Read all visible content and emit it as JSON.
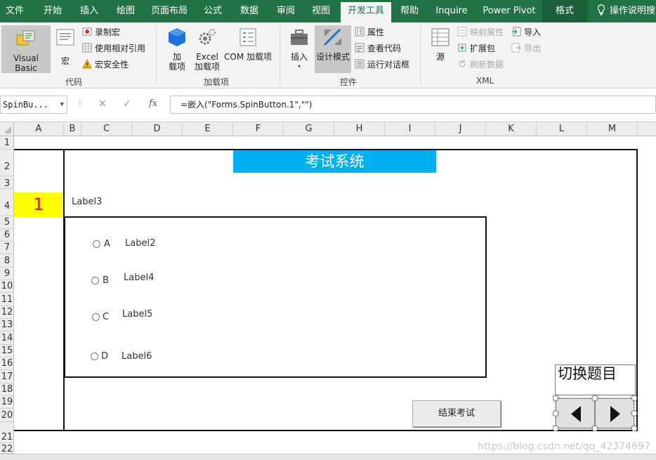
{
  "ribbon_tabs": [
    "文件",
    "开始",
    "插入",
    "绘图",
    "页面布局",
    "公式",
    "数据",
    "审阅",
    "视图",
    "开发工具",
    "帮助",
    "Inquire",
    "Power Pivot",
    "格式"
  ],
  "active_tab": "开发工具",
  "tell_me": "操作说明搜",
  "groups": {
    "code": {
      "label": "代码",
      "visual_basic": "Visual Basic",
      "macros": "宏",
      "record_macro": "录制宏",
      "relative_ref": "使用相对引用",
      "macro_security": "宏安全性"
    },
    "addins": {
      "label": "加载项",
      "addins_line1": "加",
      "addins_line2": "载项",
      "excel_addins_line1": "Excel",
      "excel_addins_line2": "加载项",
      "com_addins": "COM 加载项"
    },
    "controls": {
      "label": "控件",
      "insert": "插入",
      "design_mode": "设计模式",
      "properties": "属性",
      "view_code": "查看代码",
      "run_dialog": "运行对话框"
    },
    "xml": {
      "label": "XML",
      "source": "源",
      "map_props": "映射属性",
      "expansion": "扩展包",
      "refresh": "刷新数据",
      "import": "导入",
      "export": "导出"
    }
  },
  "formula_bar": {
    "name_box": "SpinBu...",
    "formula": "=嵌入(\"Forms.SpinButton.1\",\"\")"
  },
  "columns": [
    "A",
    "B",
    "C",
    "D",
    "E",
    "F",
    "G",
    "H",
    "I",
    "J",
    "K",
    "L",
    "M"
  ],
  "rows": [
    "1",
    "2",
    "3",
    "4",
    "5",
    "6",
    "7",
    "8",
    "9",
    "10",
    "11",
    "12",
    "13",
    "14",
    "15",
    "16",
    "17",
    "18",
    "19",
    "20",
    "21",
    "22"
  ],
  "sheet": {
    "title": "考试系统",
    "question_number": "1",
    "question_label": "Label3",
    "options": [
      {
        "letter": "A",
        "label": "Label2"
      },
      {
        "letter": "B",
        "label": "Label4"
      },
      {
        "letter": "C",
        "label": "Label5"
      },
      {
        "letter": "D",
        "label": "Label6"
      }
    ],
    "switch_label": "切换题目",
    "end_button": "结束考试",
    "watermark": "https://blog.csdn.net/qq_42374697"
  },
  "colors": {
    "ribbon_green": "#217346",
    "title_bg": "#00b0f0",
    "number_bg": "#ffff00",
    "number_fg": "#ff0000"
  }
}
